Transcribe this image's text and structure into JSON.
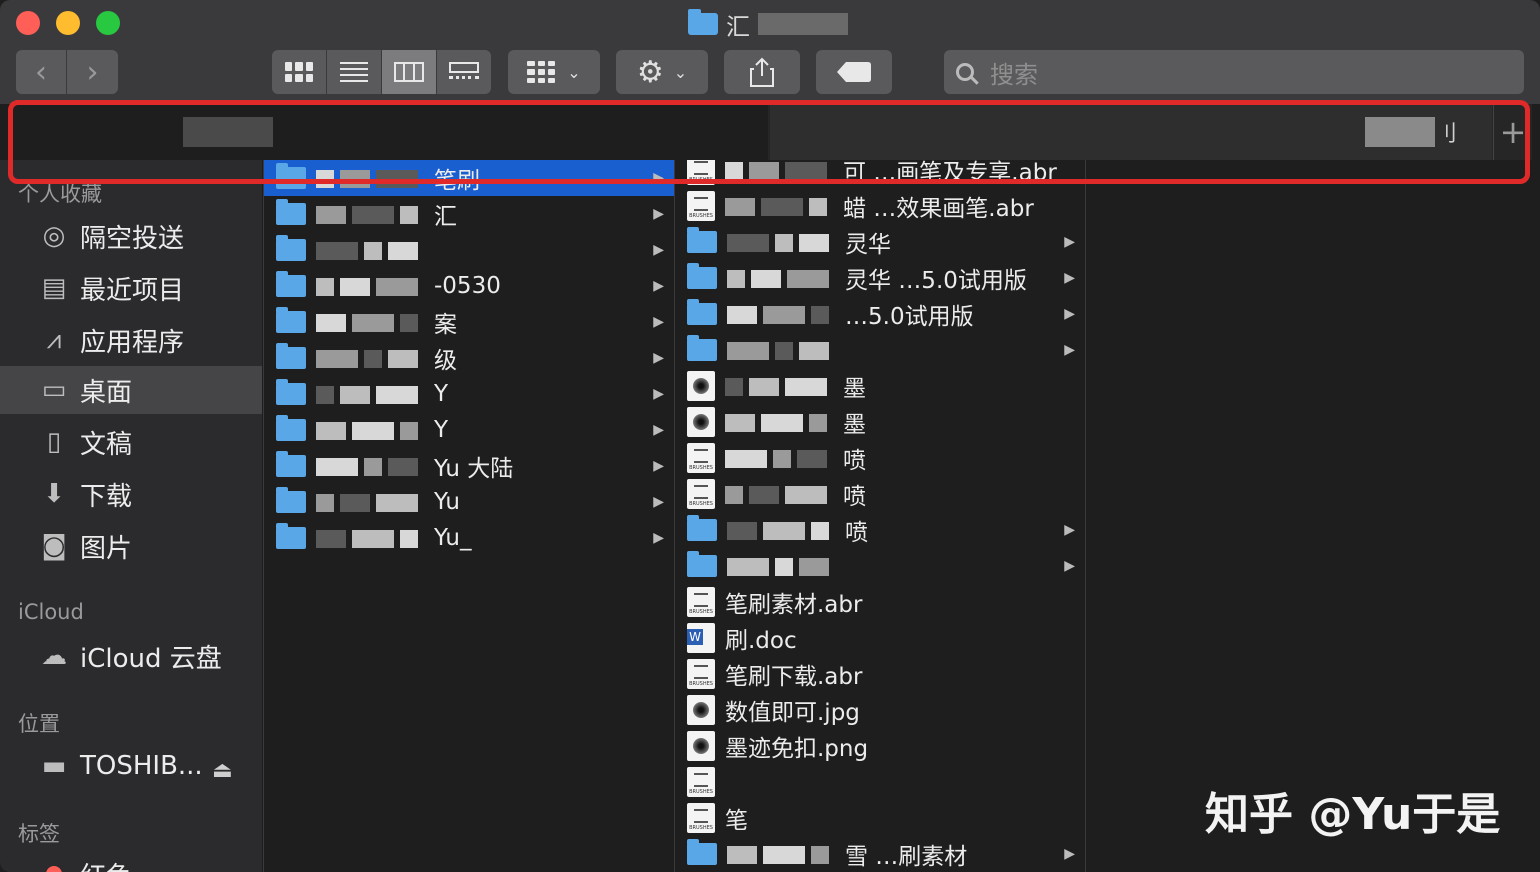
{
  "window": {
    "title_visible": "汇"
  },
  "toolbar": {
    "back_label": "‹",
    "forward_label": "›",
    "search_placeholder": "搜索"
  },
  "tabs": [
    {
      "label": ""
    },
    {
      "label": "刂"
    }
  ],
  "tab_add_label": "+",
  "sidebar": {
    "favorites_heading": "个人收藏",
    "favorites": [
      {
        "label": "隔空投送",
        "icon": "airdrop-icon"
      },
      {
        "label": "最近项目",
        "icon": "recents-icon"
      },
      {
        "label": "应用程序",
        "icon": "applications-icon"
      },
      {
        "label": "桌面",
        "icon": "desktop-icon"
      },
      {
        "label": "文稿",
        "icon": "documents-icon"
      },
      {
        "label": "下载",
        "icon": "downloads-icon"
      },
      {
        "label": "图片",
        "icon": "pictures-icon"
      }
    ],
    "icloud_heading": "iCloud",
    "icloud_items": [
      {
        "label": "iCloud 云盘",
        "icon": "cloud-icon"
      }
    ],
    "locations_heading": "位置",
    "locations": [
      {
        "label": "TOSHIB...",
        "icon": "drive-icon"
      }
    ],
    "tags_heading": "标签",
    "tags": [
      {
        "label": "红色"
      }
    ]
  },
  "column1": [
    {
      "name": "笔刷",
      "selected": true
    },
    {
      "name": "汇"
    },
    {
      "name": ""
    },
    {
      "name": "-0530"
    },
    {
      "name": "案"
    },
    {
      "name": "级"
    },
    {
      "name": "Y"
    },
    {
      "name": "Y"
    },
    {
      "name": "Yu 大陆"
    },
    {
      "name": "Yu"
    },
    {
      "name": "Yu_"
    }
  ],
  "column2": [
    {
      "name": "可 …画笔及专享.abr",
      "type": "abr"
    },
    {
      "name": "蜡 …效果画笔.abr",
      "type": "abr"
    },
    {
      "name": "灵华",
      "type": "folder"
    },
    {
      "name": "灵华 …5.0试用版",
      "type": "folder"
    },
    {
      "name": "…5.0试用版",
      "type": "folder"
    },
    {
      "name": "",
      "type": "folder"
    },
    {
      "name": "墨",
      "type": "image"
    },
    {
      "name": "墨",
      "type": "image"
    },
    {
      "name": "喷",
      "type": "abr"
    },
    {
      "name": "喷",
      "type": "abr"
    },
    {
      "name": "喷",
      "type": "folder"
    },
    {
      "name": "",
      "type": "folder"
    },
    {
      "name": "笔刷素材.abr",
      "type": "abr"
    },
    {
      "name": "刷.doc",
      "type": "doc"
    },
    {
      "name": "笔刷下载.abr",
      "type": "abr"
    },
    {
      "name": "数值即可.jpg",
      "type": "image"
    },
    {
      "name": "墨迹免扣.png",
      "type": "image"
    },
    {
      "name": "",
      "type": "abr"
    },
    {
      "name": "笔",
      "type": "abr"
    },
    {
      "name": "雪 …刷素材",
      "type": "folder"
    }
  ],
  "watermark": "知乎 @Yu于是"
}
